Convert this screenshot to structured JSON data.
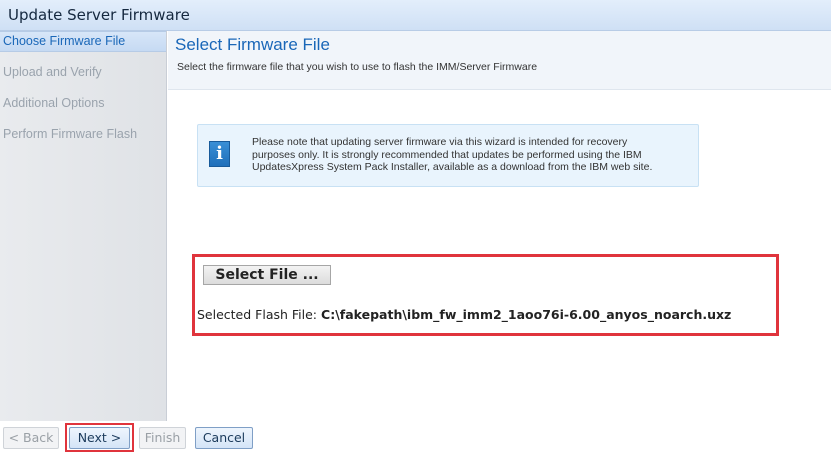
{
  "window": {
    "title": "Update Server Firmware"
  },
  "steps": [
    {
      "label": "Choose Firmware File",
      "active": true
    },
    {
      "label": "Upload and Verify",
      "active": false
    },
    {
      "label": "Additional Options",
      "active": false
    },
    {
      "label": "Perform Firmware Flash",
      "active": false
    }
  ],
  "content": {
    "title": "Select Firmware File",
    "subtitle": "Select the firmware file that you wish to use to flash the IMM/Server Firmware"
  },
  "info": {
    "icon": "info-icon",
    "lines": [
      "Please note that updating server firmware via this wizard is intended for recovery",
      "purposes only. It is strongly recommended that updates be performed using the IBM",
      "UpdatesXpress System Pack Installer, available as a download from the IBM web site."
    ]
  },
  "file": {
    "button_label": "Select File ...",
    "selected_label": "Selected Flash File:",
    "selected_path": "C:\\fakepath\\ibm_fw_imm2_1aoo76i-6.00_anyos_noarch.uxz"
  },
  "footer": {
    "back_label": "< Back",
    "next_label": "Next >",
    "finish_label": "Finish",
    "cancel_label": "Cancel"
  },
  "colors": {
    "accent": "#1a67b8",
    "highlight": "#e0343c",
    "info_bg": "#e9f4fd"
  }
}
